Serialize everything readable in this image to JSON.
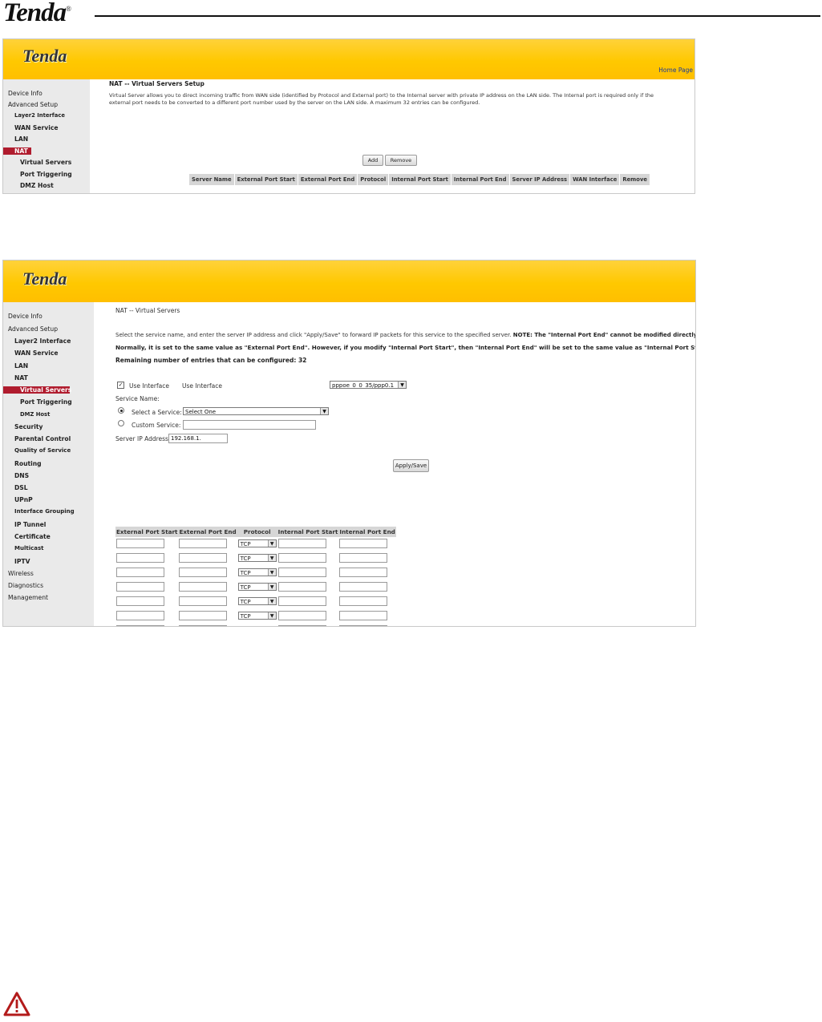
{
  "doc": {
    "logo": "Tenda",
    "logo_mark": "®"
  },
  "shot1": {
    "banner_logo": "Tenda",
    "home_link": "Home Page",
    "sidebar": [
      "Device Info",
      "Advanced Setup",
      "Layer2 Interface",
      "WAN Service",
      "LAN",
      "NAT",
      "Virtual Servers",
      "Port Triggering",
      "DMZ Host"
    ],
    "active_item": "NAT",
    "page_title": "NAT -- Virtual Servers Setup",
    "description": "Virtual Server allows you to direct incoming traffic from WAN side (identified by Protocol and External port) to the Internal server with private IP address on the LAN side. The Internal port is required only if the external port needs to be converted to a different port number used by the server on the LAN side. A maximum 32 entries can be configured.",
    "add_label": "Add",
    "remove_label": "Remove",
    "table_headers": [
      "Server Name",
      "External Port Start",
      "External Port End",
      "Protocol",
      "Internal Port Start",
      "Internal Port End",
      "Server IP Address",
      "WAN Interface",
      "Remove"
    ]
  },
  "shot2": {
    "banner_logo": "Tenda",
    "sidebar": [
      "Device Info",
      "Advanced Setup",
      "Layer2 Interface",
      "WAN Service",
      "LAN",
      "NAT",
      "Virtual Servers",
      "Port Triggering",
      "DMZ Host",
      "Security",
      "Parental Control",
      "Quality of Service",
      "Routing",
      "DNS",
      "DSL",
      "UPnP",
      "Interface Grouping",
      "IP Tunnel",
      "Certificate",
      "Multicast",
      "IPTV",
      "Wireless",
      "Diagnostics",
      "Management"
    ],
    "active_item": "Virtual Servers",
    "page_title": "NAT -- Virtual Servers",
    "instruction_1": "Select the service name, and enter the server IP address and click \"Apply/Save\" to forward IP packets for this service to the specified server.",
    "note_1": "NOTE: The \"Internal Port End\" cannot be modified directly.",
    "note_2": "Normally, it is set to the same value as \"External Port End\". However, if you modify \"Internal Port Start\", then \"Internal Port End\" will be set to the same value as \"Internal Port Start\".",
    "remaining": "Remaining number of entries that can be configured: 32",
    "use_interface_checkbox_label": "Use Interface",
    "use_interface_label": "Use Interface",
    "interface_value": "pppoe_0_0_35/ppp0.1",
    "service_name_label": "Service Name:",
    "select_service_label": "Select a Service:",
    "select_service_value": "Select One",
    "custom_service_label": "Custom Service:",
    "server_ip_label": "Server IP Address:",
    "server_ip_value": "192.168.1.",
    "apply_label": "Apply/Save",
    "port_headers": [
      "External Port Start",
      "External Port End",
      "Protocol",
      "Internal Port Start",
      "Internal Port End"
    ],
    "protocol_value": "TCP",
    "row_count": 10
  },
  "colors": {
    "banner": "#ffc800",
    "active_nav": "#b01c2e",
    "sidebar_bg": "#eaeaea"
  },
  "icons": {
    "warning": "warning-triangle-icon"
  }
}
